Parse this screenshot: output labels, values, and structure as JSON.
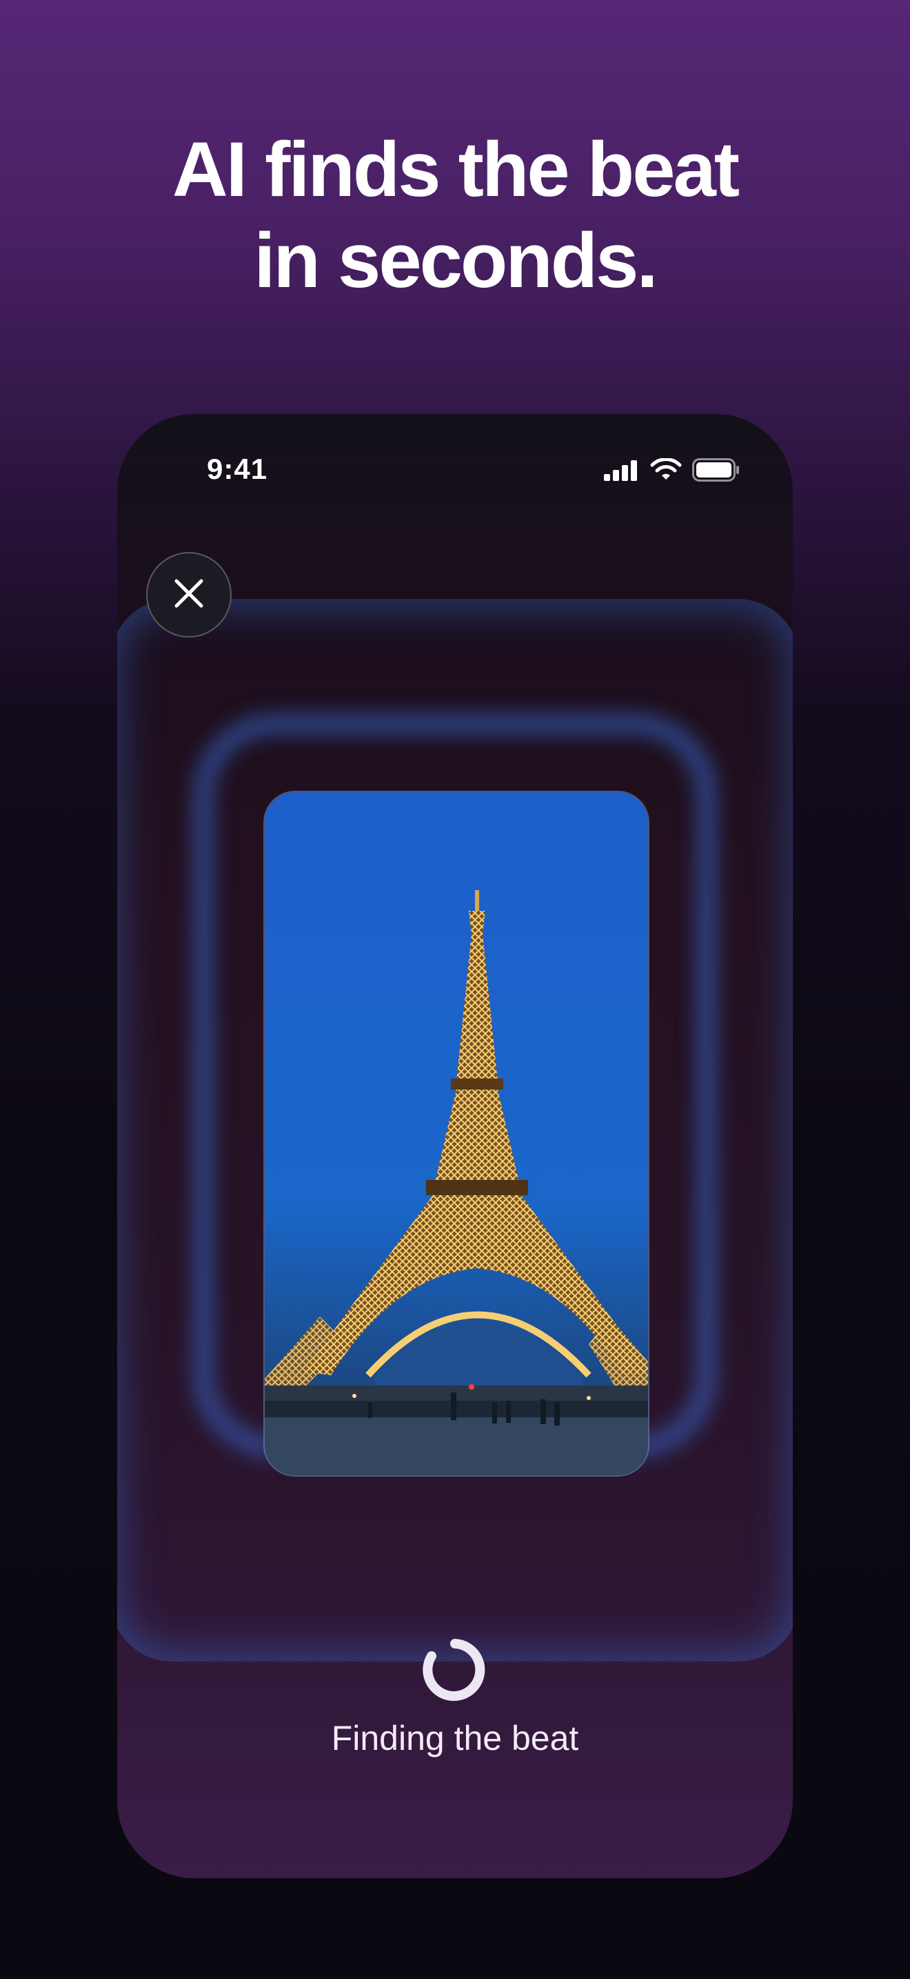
{
  "headline": {
    "line1": "AI finds the beat",
    "line2": "in seconds."
  },
  "status_bar": {
    "time": "9:41",
    "signal_icon": "cellular-signal-icon",
    "wifi_icon": "wifi-icon",
    "battery_icon": "battery-icon"
  },
  "close_button": {
    "icon": "close-icon"
  },
  "media": {
    "subject": "Eiffel Tower at dusk"
  },
  "loading": {
    "label": "Finding the beat",
    "icon": "spinner-icon"
  },
  "colors": {
    "accent_glow": "#3a6cd7",
    "background_top": "#562776",
    "background_bottom": "#0a0810"
  }
}
